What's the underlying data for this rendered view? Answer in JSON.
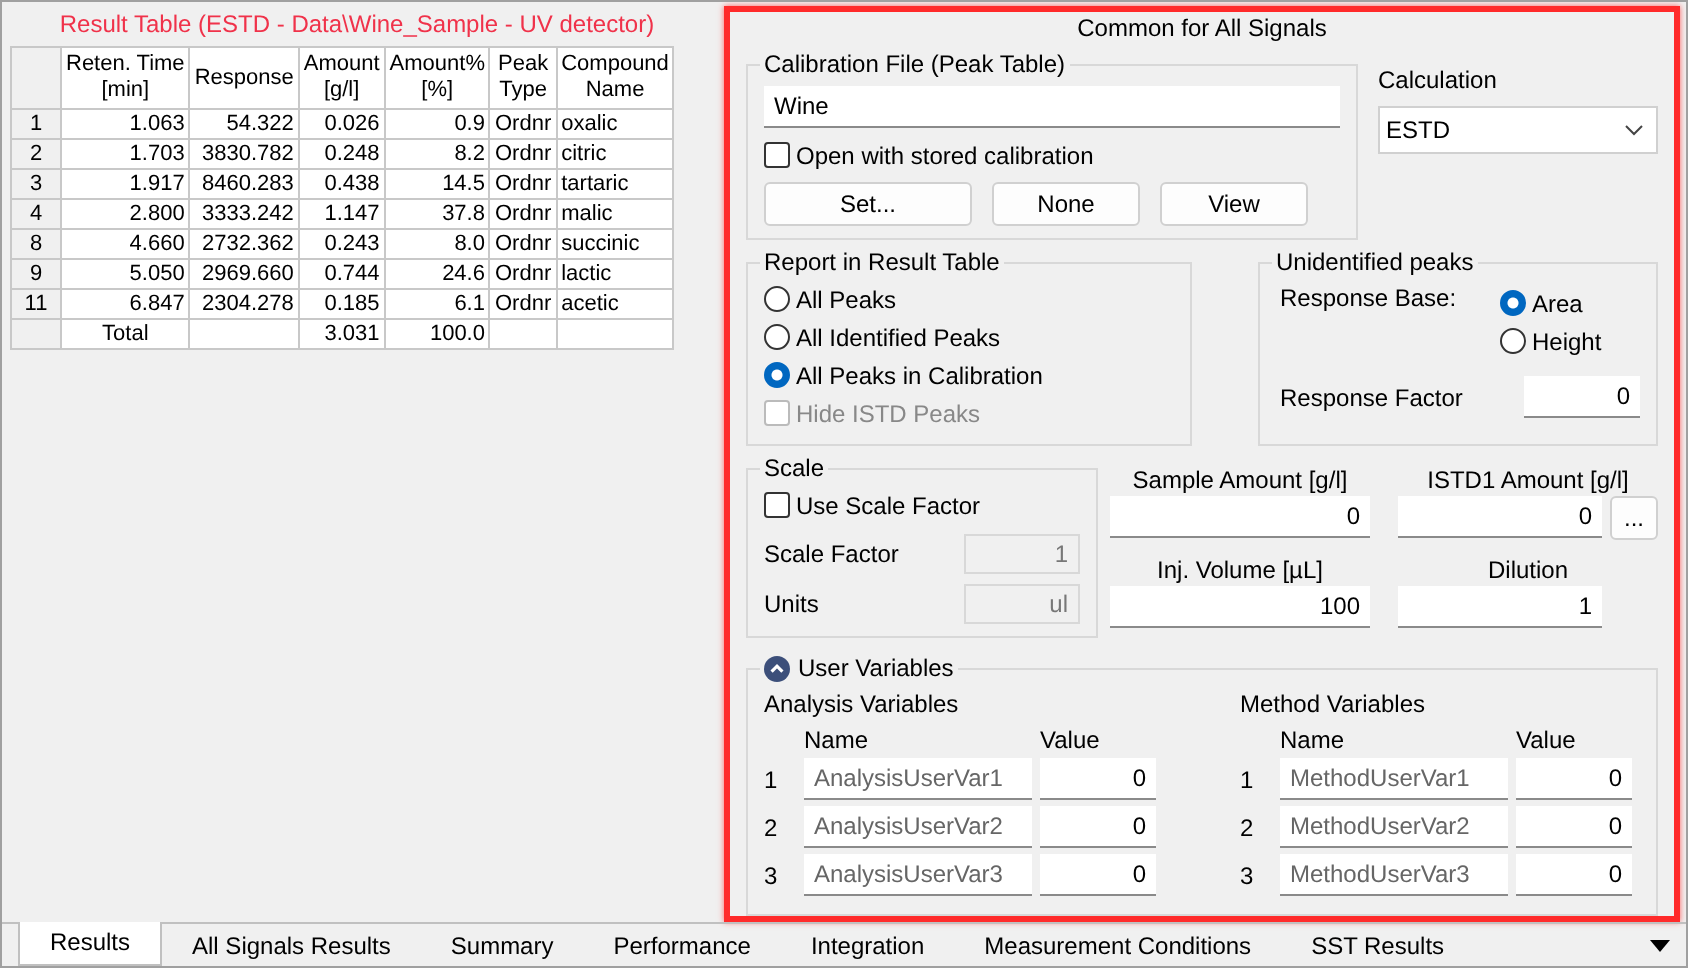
{
  "results_table": {
    "title": "Result Table (ESTD - Data\\Wine_Sample - UV detector)",
    "columns": [
      "Reten. Time\n[min]",
      "Response",
      "Amount\n[g/l]",
      "Amount%\n[%]",
      "Peak\nType",
      "Compound\nName"
    ],
    "rows": [
      {
        "index": "1",
        "cells": [
          "1.063",
          "54.322",
          "0.026",
          "0.9",
          "Ordnr",
          "oxalic"
        ]
      },
      {
        "index": "2",
        "cells": [
          "1.703",
          "3830.782",
          "0.248",
          "8.2",
          "Ordnr",
          "citric"
        ]
      },
      {
        "index": "3",
        "cells": [
          "1.917",
          "8460.283",
          "0.438",
          "14.5",
          "Ordnr",
          "tartaric"
        ]
      },
      {
        "index": "4",
        "cells": [
          "2.800",
          "3333.242",
          "1.147",
          "37.8",
          "Ordnr",
          "malic"
        ]
      },
      {
        "index": "8",
        "cells": [
          "4.660",
          "2732.362",
          "0.243",
          "8.0",
          "Ordnr",
          "succinic"
        ]
      },
      {
        "index": "9",
        "cells": [
          "5.050",
          "2969.660",
          "0.744",
          "24.6",
          "Ordnr",
          "lactic"
        ]
      },
      {
        "index": "11",
        "cells": [
          "6.847",
          "2304.278",
          "0.185",
          "6.1",
          "Ordnr",
          "acetic"
        ]
      }
    ],
    "total": {
      "label": "Total",
      "amount": "3.031",
      "percent": "100.0"
    }
  },
  "common": {
    "title": "Common for All Signals",
    "calibration_file": {
      "label": "Calibration File (Peak Table)",
      "value": "Wine",
      "open_with_stored": {
        "label": "Open with stored calibration",
        "checked": false
      },
      "buttons": [
        "Set...",
        "None",
        "View"
      ]
    },
    "calculation": {
      "label": "Calculation",
      "value": "ESTD"
    },
    "report": {
      "label": "Report in Result Table",
      "options": [
        {
          "label": "All Peaks",
          "selected": false
        },
        {
          "label": "All Identified Peaks",
          "selected": false
        },
        {
          "label": "All Peaks in Calibration",
          "selected": true
        }
      ],
      "hide_istd": {
        "label": "Hide ISTD Peaks",
        "checked": false,
        "disabled": true
      }
    },
    "unidentified": {
      "label": "Unidentified peaks",
      "response_base_label": "Response Base:",
      "options": [
        {
          "label": "Area",
          "selected": true
        },
        {
          "label": "Height",
          "selected": false
        }
      ],
      "response_factor_label": "Response Factor",
      "response_factor": "0"
    },
    "scale": {
      "label": "Scale",
      "use_scale_factor": {
        "label": "Use Scale Factor",
        "checked": false
      },
      "scale_factor_label": "Scale Factor",
      "scale_factor": "1",
      "units_label": "Units",
      "units": "ul"
    },
    "fields": [
      {
        "label": "Sample Amount [g/l]",
        "value": "0"
      },
      {
        "label": "ISTD1 Amount [g/l]",
        "value": "0"
      },
      {
        "label": "Inj. Volume [µL]",
        "value": "100"
      },
      {
        "label": "Dilution",
        "value": "1"
      }
    ],
    "more_button": "...",
    "user_variables": {
      "label": "User Variables",
      "expanded": true,
      "groups": [
        {
          "label": "Analysis Variables",
          "name_header": "Name",
          "value_header": "Value",
          "rows": [
            {
              "index": "1",
              "name": "AnalysisUserVar1",
              "value": "0"
            },
            {
              "index": "2",
              "name": "AnalysisUserVar2",
              "value": "0"
            },
            {
              "index": "3",
              "name": "AnalysisUserVar3",
              "value": "0"
            }
          ]
        },
        {
          "label": "Method Variables",
          "name_header": "Name",
          "value_header": "Value",
          "rows": [
            {
              "index": "1",
              "name": "MethodUserVar1",
              "value": "0"
            },
            {
              "index": "2",
              "name": "MethodUserVar2",
              "value": "0"
            },
            {
              "index": "3",
              "name": "MethodUserVar3",
              "value": "0"
            }
          ]
        }
      ]
    }
  },
  "tabs": [
    {
      "label": "Results",
      "selected": true
    },
    {
      "label": "All Signals Results",
      "selected": false
    },
    {
      "label": "Summary",
      "selected": false
    },
    {
      "label": "Performance",
      "selected": false
    },
    {
      "label": "Integration",
      "selected": false
    },
    {
      "label": "Measurement Conditions",
      "selected": false
    },
    {
      "label": "SST Results",
      "selected": false
    }
  ]
}
